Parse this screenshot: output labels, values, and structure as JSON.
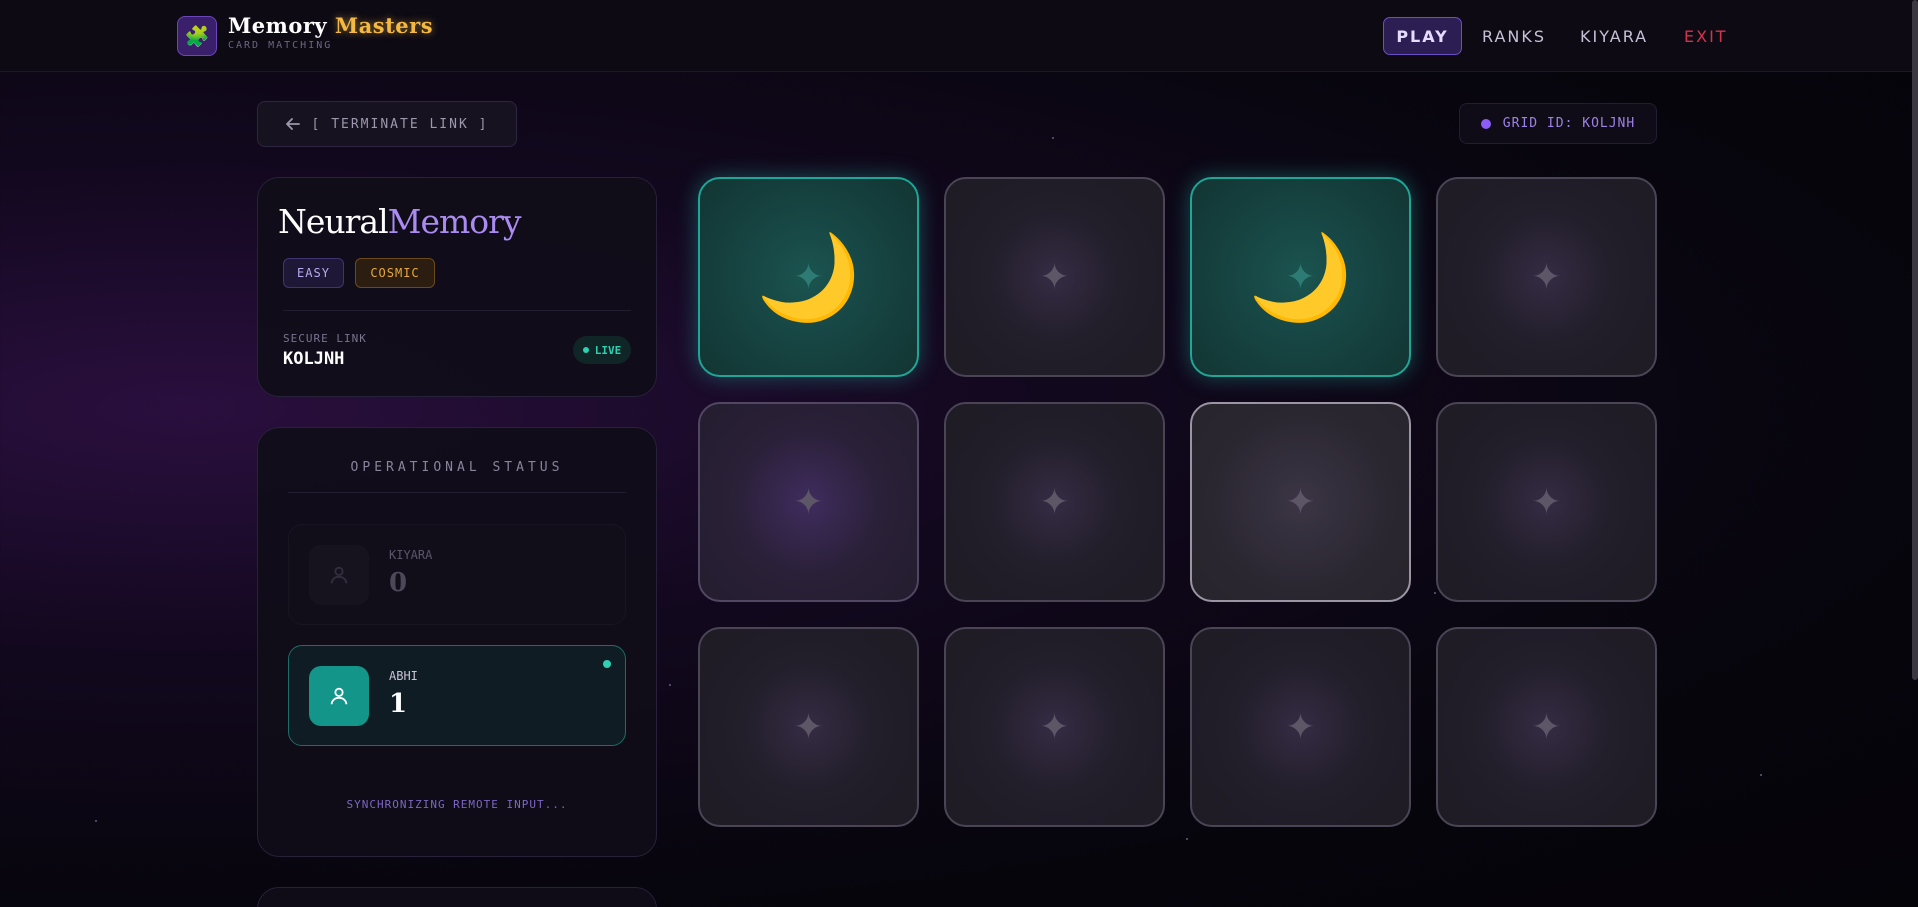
{
  "app": {
    "brand_word1": "Memory",
    "brand_word2": "Masters",
    "subtitle": "CARD MATCHING",
    "logo_icon": "puzzle-piece-icon"
  },
  "nav": {
    "play": "PLAY",
    "ranks": "RANKS",
    "user": "KIYARA",
    "exit": "EXIT"
  },
  "session": {
    "terminate_label": "[ TERMINATE LINK ]",
    "grid_id_label": "GRID ID: KOLJNH"
  },
  "game": {
    "title_word1": "Neural",
    "title_word2": "Memory",
    "difficulty": "EASY",
    "theme": "COSMIC",
    "secure_link_label": "SECURE LINK",
    "secure_link_code": "KOLJNH",
    "live_label": "LIVE"
  },
  "status": {
    "title": "OPERATIONAL STATUS",
    "players": [
      {
        "name": "KIYARA",
        "score": "0",
        "active": false
      },
      {
        "name": "ABHI",
        "score": "1",
        "active": true
      }
    ],
    "sync_message": "SYNCHRONIZING REMOTE INPUT..."
  },
  "board": {
    "hidden_symbol": "✦",
    "tiles": [
      {
        "state": "matched",
        "face": "🌙"
      },
      {
        "state": "hidden",
        "face": ""
      },
      {
        "state": "matched",
        "face": "🌙"
      },
      {
        "state": "hidden",
        "face": ""
      },
      {
        "state": "hidden-purple",
        "face": ""
      },
      {
        "state": "hidden",
        "face": ""
      },
      {
        "state": "hover",
        "face": ""
      },
      {
        "state": "hidden",
        "face": ""
      },
      {
        "state": "hidden",
        "face": ""
      },
      {
        "state": "hidden",
        "face": ""
      },
      {
        "state": "hidden",
        "face": ""
      },
      {
        "state": "hidden",
        "face": ""
      }
    ]
  },
  "colors": {
    "accent_purple": "#8b5cf6",
    "accent_gold": "#f4b942",
    "match_teal": "#1fa697",
    "exit_red": "#d2344b"
  }
}
